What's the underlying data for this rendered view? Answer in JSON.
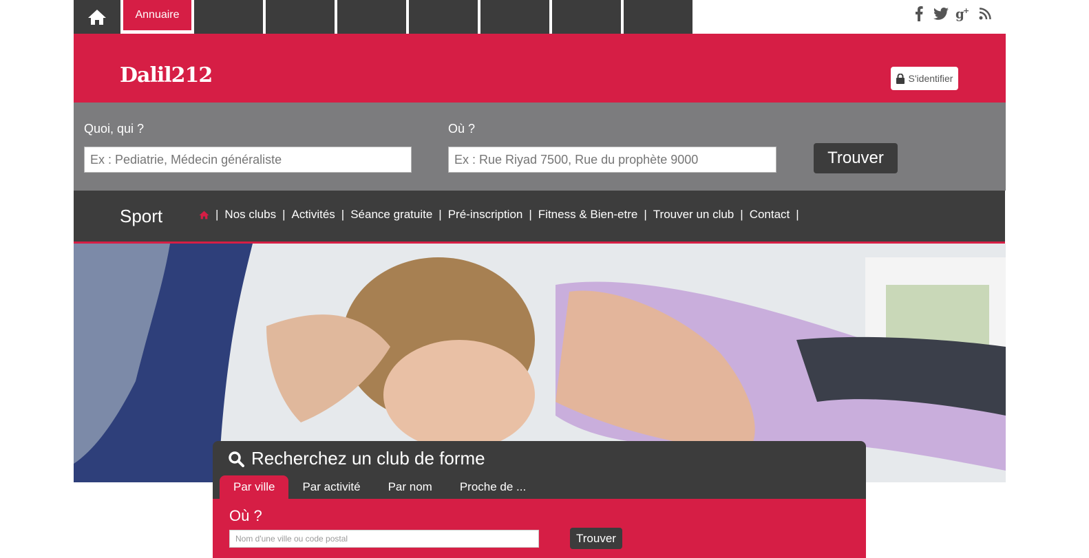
{
  "topnav": {
    "annuaire_label": "Annuaire",
    "empty_tab_count": 7
  },
  "social": [
    "facebook-icon",
    "twitter-icon",
    "google-plus-icon",
    "rss-icon"
  ],
  "header": {
    "logo": "Dalil212",
    "login_label": "S'identifier"
  },
  "search": {
    "what_label": "Quoi, qui ?",
    "what_placeholder": "Ex : Pediatrie, Médecin généraliste",
    "where_label": "Où ?",
    "where_placeholder": "Ex : Rue Riyad 7500, Rue du prophète 9000",
    "button_label": "Trouver"
  },
  "section": {
    "title": "Sport",
    "menu": [
      "Nos clubs",
      "Activités",
      "Séance gratuite",
      "Pré-inscription",
      "Fitness & Bien-etre",
      "Trouver un club",
      "Contact"
    ]
  },
  "panel": {
    "title": "Recherchez un club de forme",
    "tabs": [
      "Par ville",
      "Par activité",
      "Par nom",
      "Proche de ..."
    ],
    "active_tab": "Par ville",
    "where_label": "Où ?",
    "where_placeholder": "Nom d'une ville ou code postal",
    "button_label": "Trouver"
  },
  "colors": {
    "brand_red": "#d61e45",
    "dark": "#3c3c3c",
    "grey_band": "#7c7c7e"
  }
}
